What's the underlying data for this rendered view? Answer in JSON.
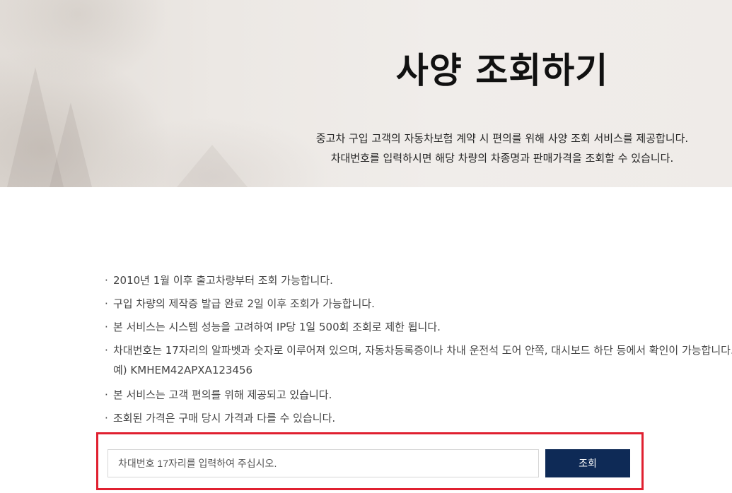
{
  "hero": {
    "title": "사양 조회하기",
    "description_lines": [
      "중고차 구입 고객의 자동차보험 계약 시 편의를 위해 사양 조회 서비스를 제공합니다.",
      "차대번호를 입력하시면 해당 차량의 차종명과 판매가격을 조회할 수 있습니다."
    ]
  },
  "notices": [
    {
      "bullet": "·",
      "text": "2010년 1월 이후 출고차량부터 조회 가능합니다."
    },
    {
      "bullet": "·",
      "text": "구입 차량의 제작증 발급 완료 2일 이후 조회가 가능합니다."
    },
    {
      "bullet": "·",
      "text": "본 서비스는 시스템 성능을 고려하여 IP당 1일 500회 조회로 제한 됩니다."
    },
    {
      "bullet": "·",
      "text": "차대번호는 17자리의 알파벳과 숫자로 이루어져 있으며, 자동차등록증이나 차내 운전석 도어 안쪽, 대시보드 하단 등에서 확인이 가능합니다.",
      "example": "예) KMHEM42APXA123456"
    },
    {
      "bullet": "·",
      "text": "본 서비스는 고객 편의를 위해 제공되고 있습니다."
    },
    {
      "bullet": "·",
      "text": "조회된 가격은 구매 당시 가격과 다를 수 있습니다."
    }
  ],
  "search": {
    "placeholder": "차대번호 17자리를 입력하여 주십시오.",
    "value": "",
    "button_label": "조회"
  },
  "colors": {
    "button_bg": "#0e2a56",
    "highlight_border": "#e02030"
  }
}
